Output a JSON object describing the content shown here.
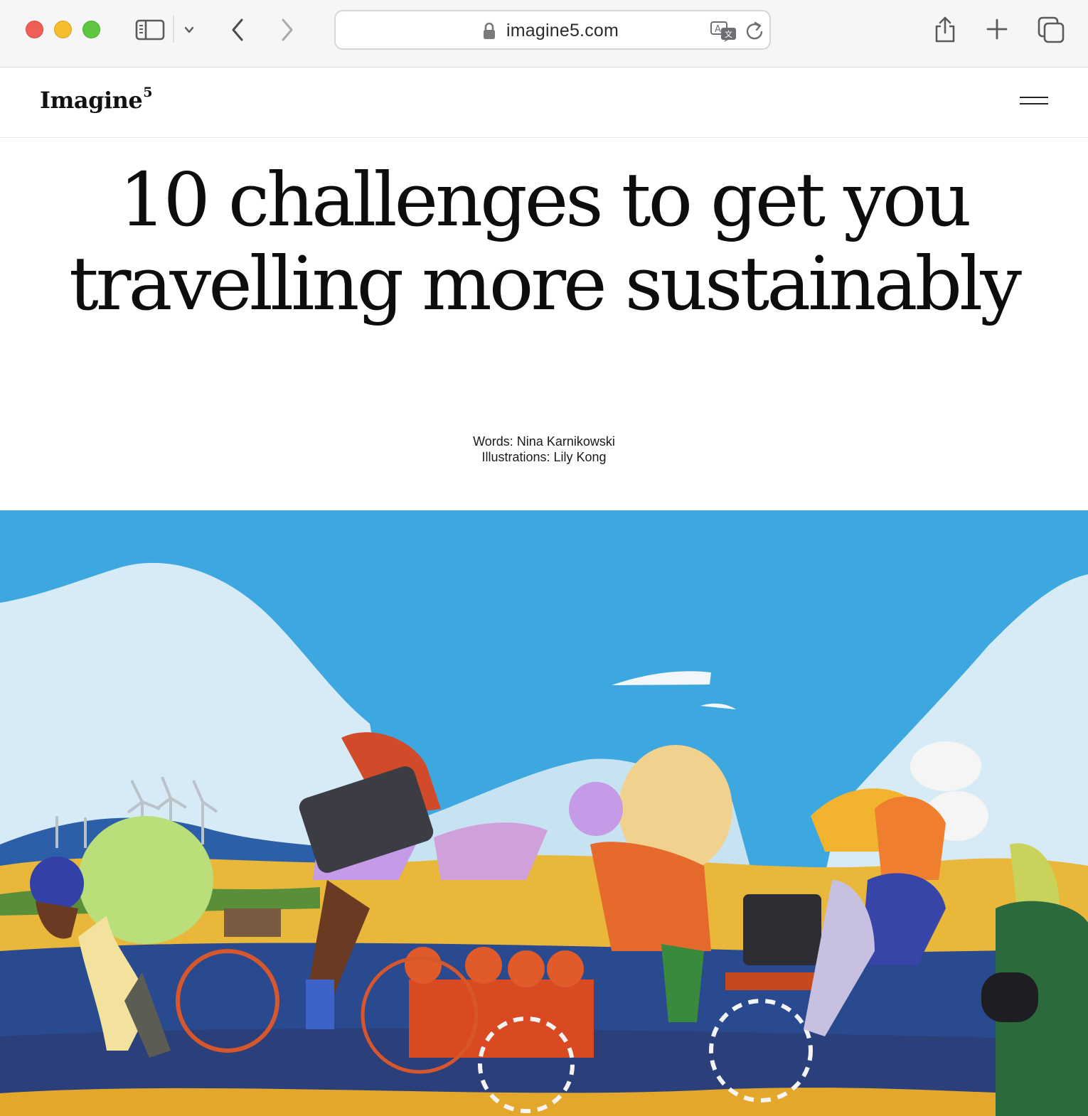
{
  "browser": {
    "url": "imagine5.com",
    "icons": {
      "sidebar": "sidebar-icon",
      "tab_overview_chevron": "chevron-down-icon",
      "back": "chevron-left-icon",
      "forward": "chevron-right-icon",
      "lock": "lock-icon",
      "translate": "translate-icon",
      "reload": "reload-icon",
      "share": "share-icon",
      "new_tab": "plus-icon",
      "tabs": "tabs-overview-icon"
    }
  },
  "site": {
    "logo_text": "Imagine",
    "logo_superscript": "5",
    "menu_icon": "hamburger-menu-icon"
  },
  "article": {
    "title_line1": "10 challenges to get you",
    "title_line2": "travelling more sustainably",
    "words_credit": "Words: Nina Karnikowski",
    "illustrations_credit": "Illustrations: Lily Kong"
  },
  "hero": {
    "sky_color": "#3da7e0",
    "cloud_color": "#d6ebf5",
    "field_color": "#e9b73a",
    "water_color": "#2a4a8f"
  }
}
